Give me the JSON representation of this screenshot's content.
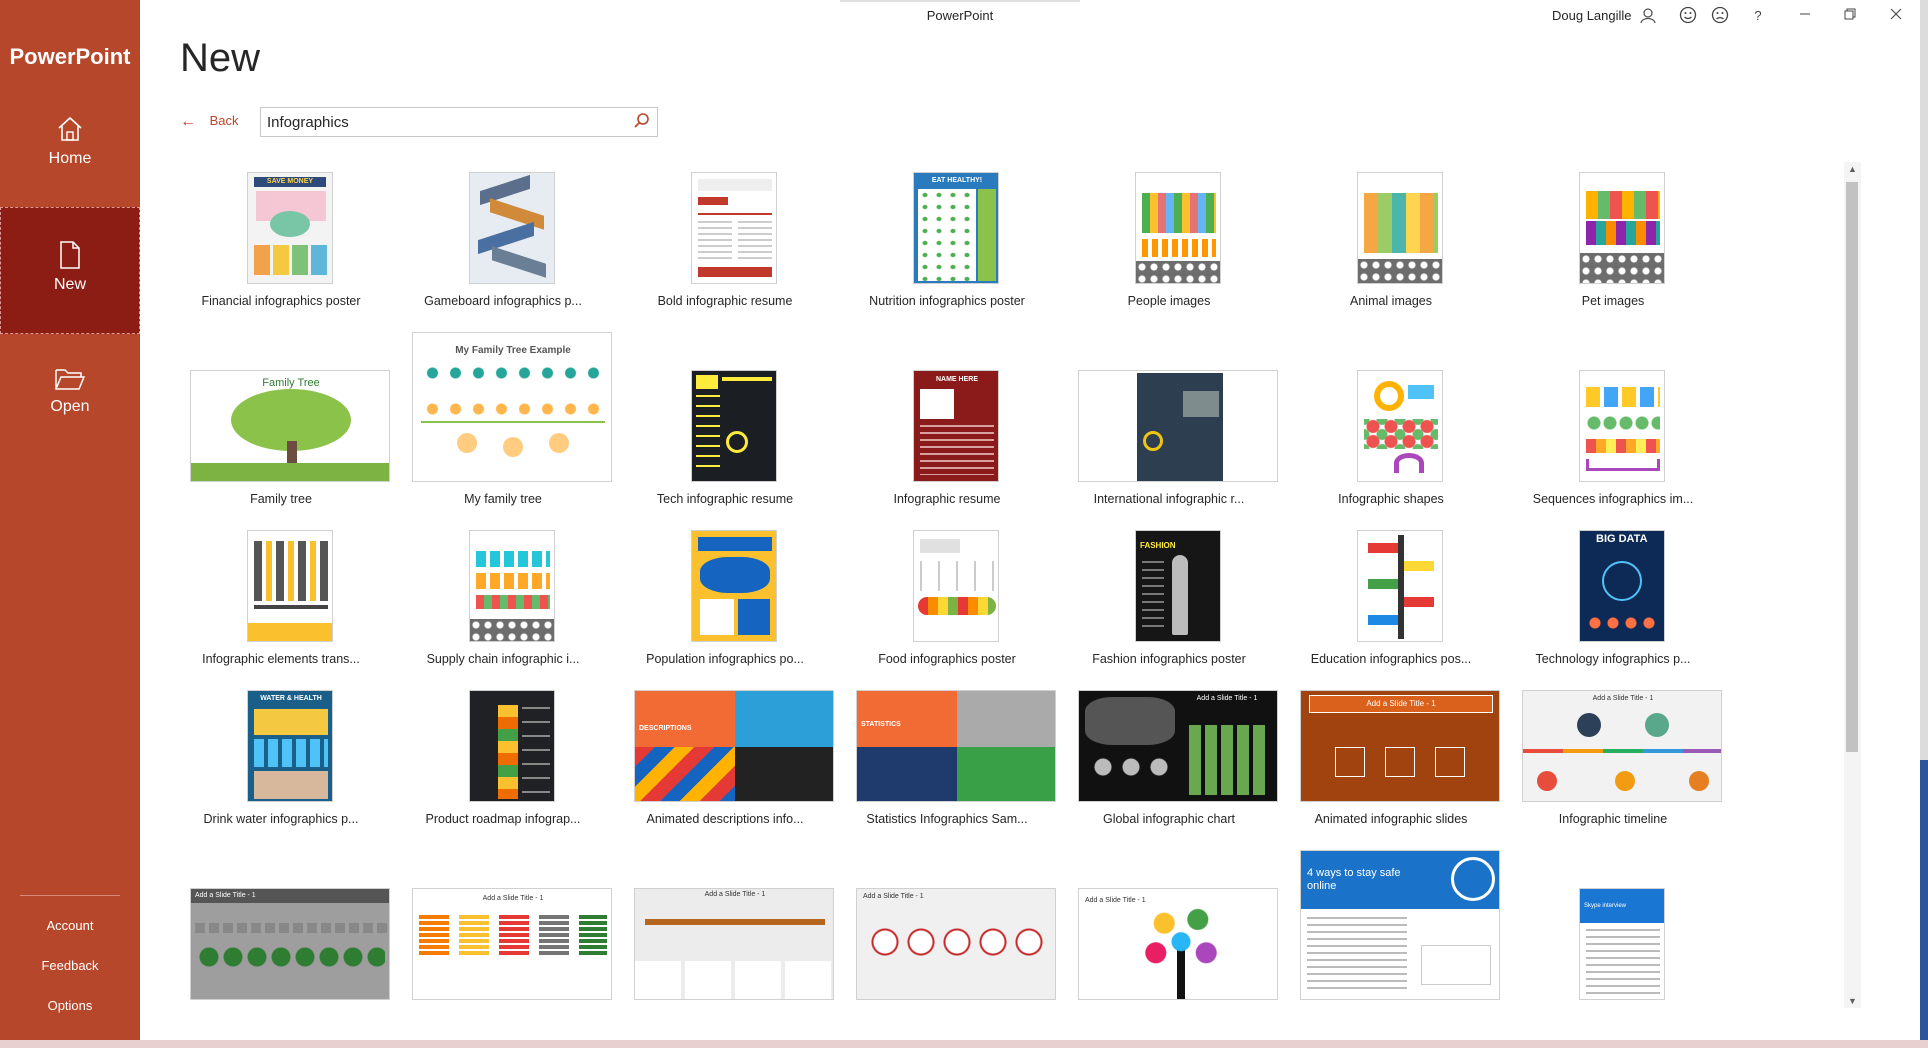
{
  "window": {
    "title": "PowerPoint",
    "user": "Doug Langille",
    "icons": [
      "smiley-icon",
      "frown-icon",
      "help-icon",
      "minimize-icon",
      "restore-icon",
      "close-icon"
    ],
    "help_glyph": "?"
  },
  "sidebar": {
    "app_name": "PowerPoint",
    "nav": [
      {
        "label": "Home",
        "icon": "home-icon"
      },
      {
        "label": "New",
        "icon": "new-document-icon",
        "selected": true
      },
      {
        "label": "Open",
        "icon": "folder-open-icon"
      }
    ],
    "bottom": [
      "Account",
      "Feedback",
      "Options"
    ]
  },
  "main": {
    "title": "New",
    "back_label": "Back",
    "search": {
      "value": "Infographics",
      "placeholder": ""
    }
  },
  "templates": [
    [
      "Financial infographics poster",
      "Gameboard infographics p...",
      "Bold infographic resume",
      "Nutrition infographics poster",
      "People images",
      "Animal images",
      "Pet images"
    ],
    [
      "Family tree",
      "My family tree",
      "Tech infographic resume",
      "Infographic resume",
      "International infographic r...",
      "Infographic shapes",
      "Sequences infographics im..."
    ],
    [
      "Infographic elements trans...",
      "Supply chain infographic i...",
      "Population infographics po...",
      "Food infographics poster",
      "Fashion infographics poster",
      "Education infographics pos...",
      "Technology infographics p..."
    ],
    [
      "Drink water infographics p...",
      "Product roadmap infograp...",
      "Animated descriptions info...",
      "Statistics Infographics Sam...",
      "Global infographic chart",
      "Animated infographic slides",
      "Infographic timeline"
    ],
    [
      "",
      "",
      "",
      "",
      "",
      "",
      ""
    ]
  ],
  "thumb_text": {
    "save_money": "SAVE MONEY",
    "eat_healthy": "EAT HEALTHY!",
    "family_tree": "Family Tree",
    "my_family_tree": "My Family Tree Example",
    "name_here": "NAME HERE",
    "big_data": "BIG DATA",
    "water_health": "WATER & HEALTH",
    "fashion": "FASHION",
    "descriptions": "DESCRIPTIONS",
    "statistics": "STATISTICS",
    "add_slide_title": "Add a Slide Title - 1",
    "stay_safe": "4 ways to stay safe online",
    "skype": "Skype interview"
  }
}
